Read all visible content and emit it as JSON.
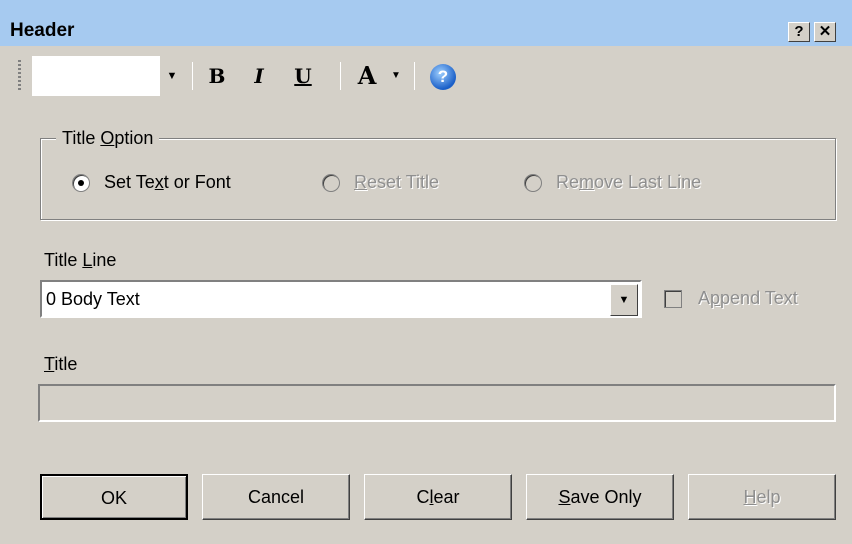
{
  "window": {
    "title": "Header",
    "help_btn": "?",
    "close_btn": "✕"
  },
  "toolbar": {
    "font_value": "",
    "bold": "B",
    "italic": "I",
    "underline": "U",
    "font_color": "A",
    "help_icon": "?"
  },
  "title_option": {
    "legend_pre": "Title ",
    "legend_acc": "O",
    "legend_post": "ption",
    "radios": [
      {
        "pre": "Set Te",
        "acc": "x",
        "post": "t or Font",
        "checked": true,
        "enabled": true
      },
      {
        "pre": "",
        "acc": "R",
        "post": "eset Title",
        "checked": false,
        "enabled": false
      },
      {
        "pre": "Re",
        "acc": "m",
        "post": "ove Last Line",
        "checked": false,
        "enabled": false
      }
    ]
  },
  "title_line": {
    "label_pre": "Title ",
    "label_acc": "L",
    "label_post": "ine",
    "value": "0 Body Text",
    "append_pre": "A",
    "append_acc": "p",
    "append_post": "pend Text"
  },
  "title": {
    "label_acc": "T",
    "label_post": "itle",
    "value": ""
  },
  "buttons": {
    "ok": "OK",
    "cancel": "Cancel",
    "clear_pre": "C",
    "clear_acc": "l",
    "clear_post": "ear",
    "save_acc": "S",
    "save_post": "ave Only",
    "help_acc": "H",
    "help_post": "elp"
  }
}
